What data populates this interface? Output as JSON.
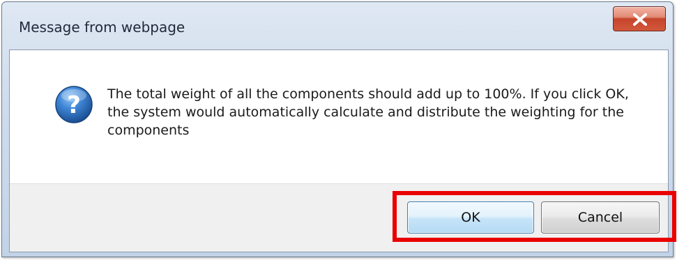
{
  "dialog": {
    "title": "Message from webpage",
    "message": "The total weight of all the components should add up to 100%. If you click OK, the system would automatically calculate and distribute the weighting for the components",
    "icon": "question-icon",
    "close_icon": "close-icon"
  },
  "buttons": {
    "ok_label": "OK",
    "cancel_label": "Cancel"
  },
  "colors": {
    "highlight_border": "#ea0000",
    "close_button": "#c6452c",
    "icon_blue": "#1f5fa8"
  }
}
